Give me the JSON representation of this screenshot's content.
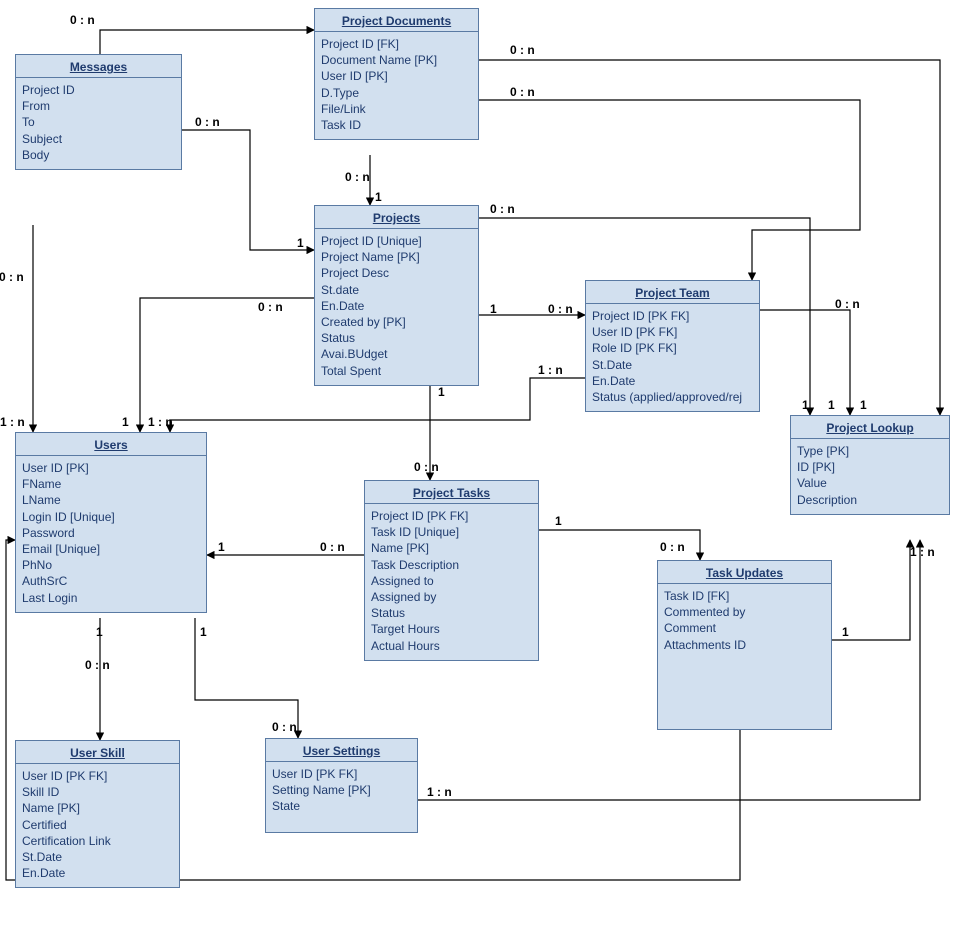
{
  "entities": {
    "messages": {
      "title": "Messages",
      "attrs": [
        "Project ID",
        "From",
        "To",
        "Subject",
        "Body"
      ]
    },
    "project_documents": {
      "title": "Project Documents",
      "attrs": [
        "Project ID [FK]",
        "Document Name [PK]",
        "User ID [PK]",
        "D.Type",
        "File/Link",
        "Task ID"
      ]
    },
    "projects": {
      "title": "Projects",
      "attrs": [
        "Project ID [Unique]",
        "Project Name [PK]",
        "Project Desc",
        "St.date",
        "En.Date",
        "Created by [PK]",
        "Status",
        "Avai.BUdget",
        "Total Spent"
      ]
    },
    "project_team": {
      "title": "Project Team",
      "attrs": [
        "Project ID [PK FK]",
        "User ID [PK FK]",
        "Role ID [PK FK]",
        "St.Date",
        "En.Date",
        "Status (applied/approved/rej"
      ]
    },
    "project_lookup": {
      "title": "Project Lookup",
      "attrs": [
        "Type [PK]",
        "ID [PK]",
        "Value",
        "Description"
      ]
    },
    "users": {
      "title": "Users",
      "attrs": [
        "User ID [PK]",
        "FName",
        "LName",
        "Login ID [Unique]",
        "Password",
        "Email  [Unique]",
        "PhNo",
        "AuthSrC",
        "Last Login"
      ]
    },
    "project_tasks": {
      "title": "Project Tasks",
      "attrs": [
        "Project ID [PK FK]",
        "Task ID [Unique]",
        "Name [PK]",
        "Task Description",
        "Assigned to",
        "Assigned by",
        "Status",
        "Target Hours",
        "Actual Hours"
      ]
    },
    "task_updates": {
      "title": "Task Updates",
      "attrs": [
        "Task ID [FK]",
        "Commented by",
        "Comment",
        "Attachments ID"
      ]
    },
    "user_settings": {
      "title": "User Settings",
      "attrs": [
        "User ID [PK FK]",
        "Setting Name [PK]",
        "State"
      ]
    },
    "user_skill": {
      "title": "User Skill",
      "attrs": [
        "User ID [PK FK]",
        "Skill ID",
        "Name [PK]",
        "Certified",
        "Certification Link",
        "St.Date",
        "En.Date"
      ]
    }
  },
  "labels": {
    "zn": "0 : n",
    "on": "1 : n",
    "one": "1"
  }
}
